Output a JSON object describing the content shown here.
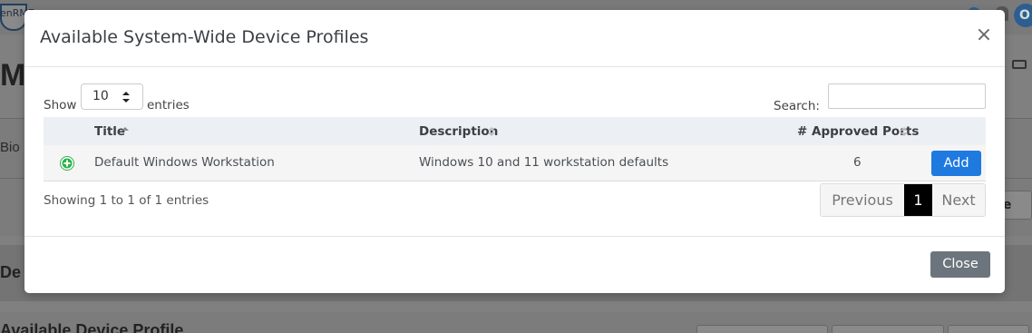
{
  "background": {
    "logo_text": "enRME",
    "avatar_letter": "O",
    "page_title": "M",
    "bio_text": "Bio",
    "re_button": "re",
    "section_label": "De",
    "bottom_title": "Available Device Profile"
  },
  "modal": {
    "title": "Available System-Wide Device Profiles",
    "close_icon": "×",
    "length": {
      "show_label": "Show",
      "value": "10",
      "entries_label": "entries"
    },
    "search": {
      "label": "Search:",
      "value": ""
    },
    "columns": [
      "Title",
      "Description",
      "# Approved Ports"
    ],
    "rows": [
      {
        "title": "Default Windows Workstation",
        "description": "Windows 10 and 11 workstation defaults",
        "approved_ports": "6",
        "action": "Add"
      }
    ],
    "info": "Showing 1 to 1 of 1 entries",
    "pagination": {
      "previous": "Previous",
      "current": "1",
      "next": "Next"
    },
    "footer_close": "Close"
  },
  "colors": {
    "primary": "#1f7ae0",
    "secondary": "#6c757d",
    "header_bg": "#ecf0f5",
    "row_bg": "#f5f5f5",
    "expand_green": "#2db24a"
  }
}
